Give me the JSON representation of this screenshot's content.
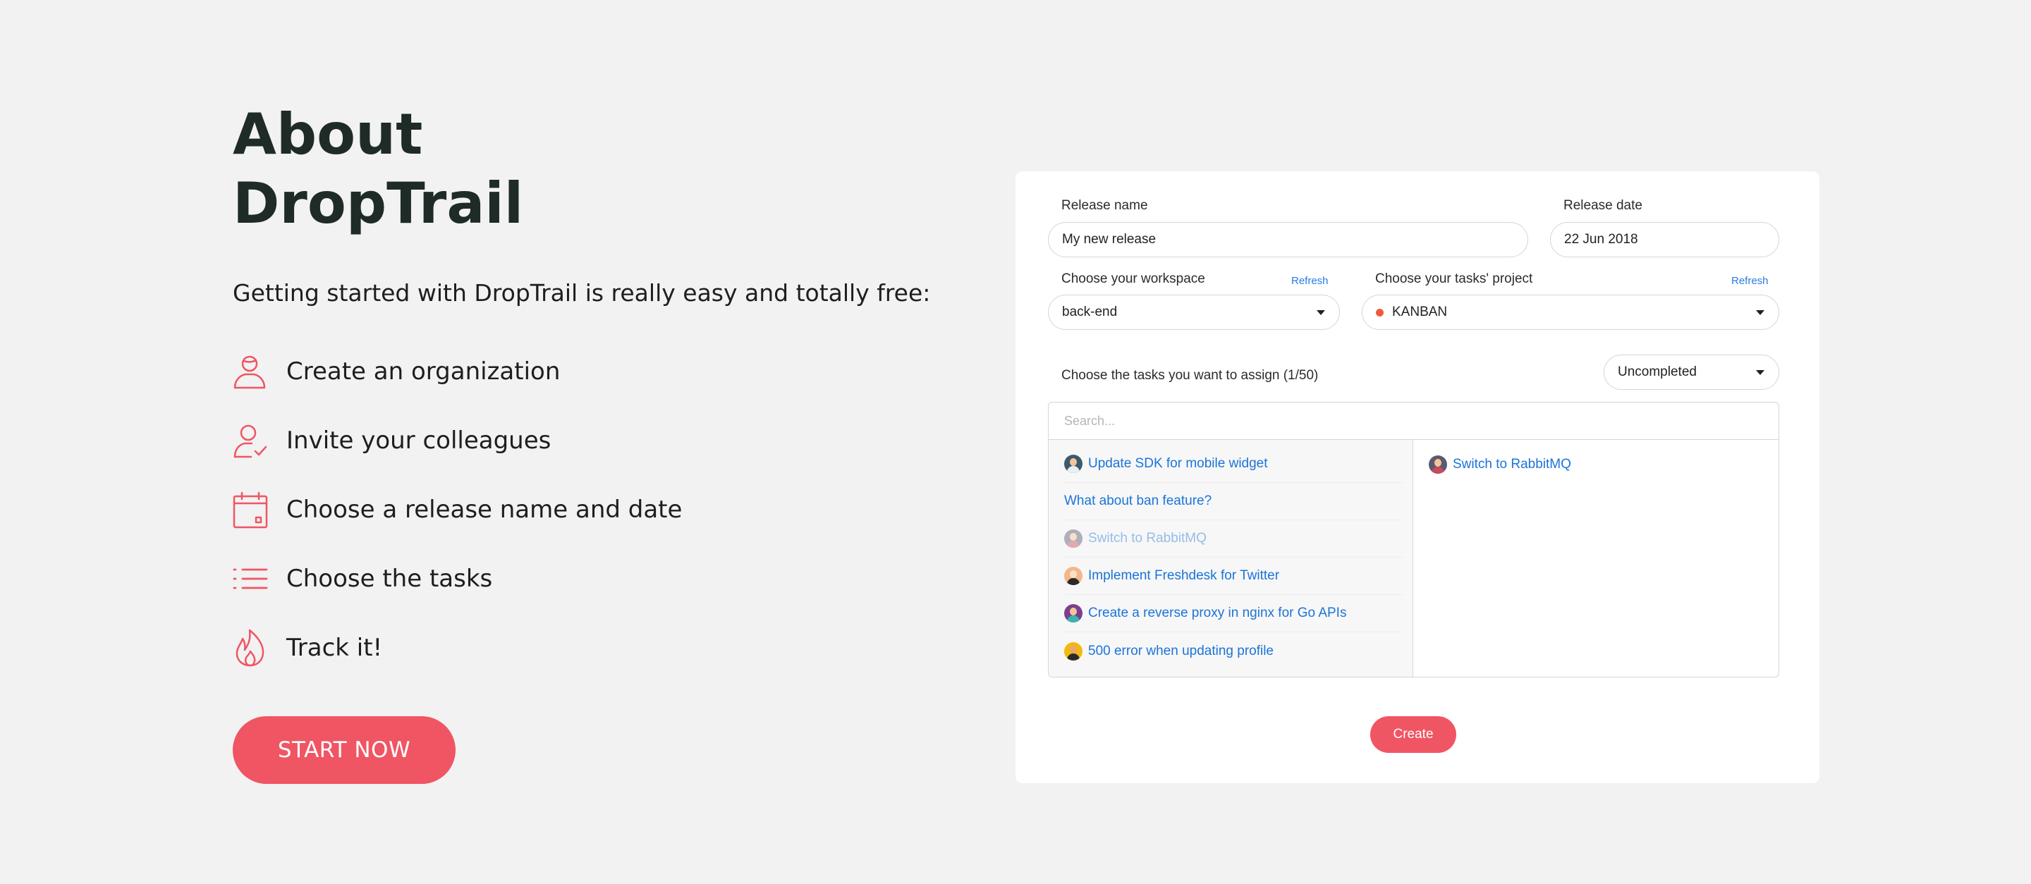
{
  "hero": {
    "title_line1": "About",
    "title_line2": "DropTrail",
    "subtitle": "Getting started with DropTrail is really easy and totally free:",
    "steps": [
      {
        "label": "Create an organization",
        "icon": "user-icon"
      },
      {
        "label": "Invite your colleagues",
        "icon": "user-check-icon"
      },
      {
        "label": "Choose a release name and date",
        "icon": "calendar-icon"
      },
      {
        "label": "Choose the tasks",
        "icon": "list-icon"
      },
      {
        "label": "Track it!",
        "icon": "flame-icon"
      }
    ],
    "cta_label": "START NOW"
  },
  "form": {
    "release_name_label": "Release name",
    "release_name_value": "My new release",
    "release_date_label": "Release date",
    "release_date_value": "22 Jun 2018",
    "workspace_label": "Choose your workspace",
    "workspace_refresh": "Refresh",
    "workspace_value": "back-end",
    "project_label": "Choose your tasks' project",
    "project_refresh": "Refresh",
    "project_value": "KANBAN",
    "tasks_label": "Choose the tasks you want to assign (1/50)",
    "filter_value": "Uncompleted",
    "search_placeholder": "Search...",
    "available_tasks": [
      {
        "title": "Update SDK for mobile widget",
        "avatar": true,
        "disabled": false
      },
      {
        "title": "What about ban feature?",
        "avatar": false,
        "disabled": false
      },
      {
        "title": "Switch to RabbitMQ",
        "avatar": true,
        "disabled": true
      },
      {
        "title": "Implement Freshdesk for Twitter",
        "avatar": true,
        "disabled": false
      },
      {
        "title": "Create a reverse proxy in nginx for Go APIs",
        "avatar": true,
        "disabled": false
      },
      {
        "title": "500 error when updating profile",
        "avatar": true,
        "disabled": false
      }
    ],
    "selected_tasks": [
      {
        "title": "Switch to RabbitMQ",
        "avatar": true
      }
    ],
    "create_label": "Create"
  },
  "colors": {
    "accent": "#f05563",
    "link": "#1a74d9",
    "project_dot": "#f05a3c"
  }
}
